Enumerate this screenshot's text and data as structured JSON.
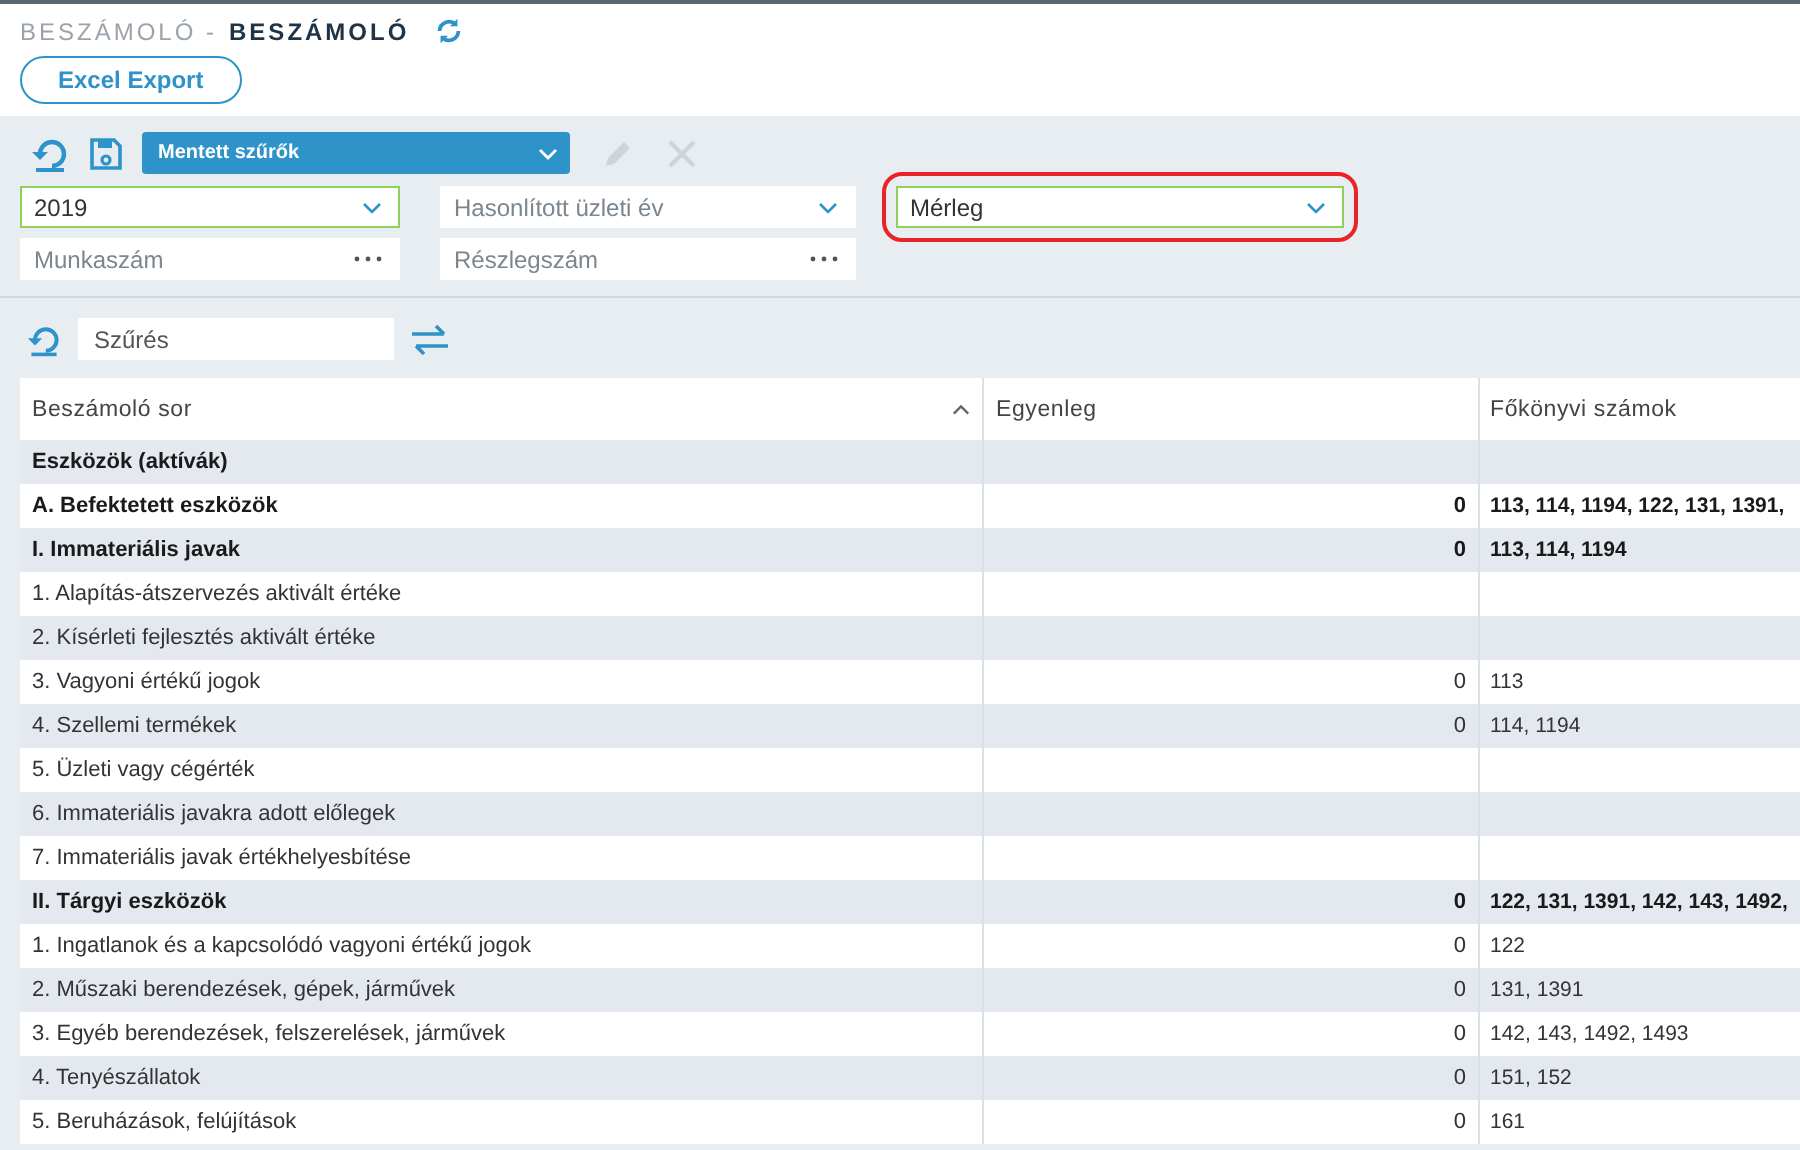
{
  "header": {
    "breadcrumb": "BESZÁMOLÓ -",
    "title": "BESZÁMOLÓ",
    "export_button": "Excel Export"
  },
  "filters": {
    "saved_filters": "Mentett szűrők",
    "edit_disabled": true,
    "delete_disabled": true,
    "fields": [
      {
        "kind": "select",
        "value": "2019",
        "valid": true,
        "highlighted": false
      },
      {
        "kind": "select",
        "placeholder": "Hasonlított üzleti év",
        "valid": false,
        "highlighted": false
      },
      {
        "kind": "select",
        "value": "Mérleg",
        "valid": true,
        "highlighted": true
      },
      {
        "kind": "lookup",
        "placeholder": "Munkaszám",
        "valid": false,
        "highlighted": false
      },
      {
        "kind": "lookup",
        "placeholder": "Részlegszám",
        "valid": false,
        "highlighted": false
      }
    ],
    "search_placeholder": "Szűrés"
  },
  "table": {
    "columns": [
      "Beszámoló sor",
      "Egyenleg",
      "Főkönyvi számok"
    ],
    "rows": [
      {
        "label": "Eszközök (aktívák)",
        "bold": true
      },
      {
        "label": "A. Befektetett eszközök",
        "balance": "0",
        "accounts": "113, 114, 1194, 122, 131, 1391,",
        "bold": true
      },
      {
        "label": "I. Immateriális javak",
        "balance": "0",
        "accounts": "113, 114, 1194",
        "bold": true
      },
      {
        "label": "1. Alapítás-átszervezés aktivált értéke",
        "bold": false
      },
      {
        "label": "2. Kísérleti fejlesztés aktivált értéke",
        "bold": false
      },
      {
        "label": "3. Vagyoni értékű jogok",
        "balance": "0",
        "accounts": "113",
        "bold": false
      },
      {
        "label": "4. Szellemi termékek",
        "balance": "0",
        "accounts": "114, 1194",
        "bold": false
      },
      {
        "label": "5. Üzleti vagy cégérték",
        "bold": false
      },
      {
        "label": "6. Immateriális javakra adott előlegek",
        "bold": false
      },
      {
        "label": "7. Immateriális javak értékhelyesbítése",
        "bold": false
      },
      {
        "label": "II. Tárgyi eszközök",
        "balance": "0",
        "accounts": "122, 131, 1391, 142, 143, 1492,",
        "bold": true
      },
      {
        "label": "1. Ingatlanok és a kapcsolódó vagyoni értékű jogok",
        "balance": "0",
        "accounts": "122",
        "bold": false
      },
      {
        "label": "2. Műszaki berendezések, gépek, járművek",
        "balance": "0",
        "accounts": "131, 1391",
        "bold": false
      },
      {
        "label": "3. Egyéb berendezések, felszerelések, járművek",
        "balance": "0",
        "accounts": "142, 143, 1492, 1493",
        "bold": false
      },
      {
        "label": "4. Tenyészállatok",
        "balance": "0",
        "accounts": "151, 152",
        "bold": false
      },
      {
        "label": "5. Beruházások, felújítások",
        "balance": "0",
        "accounts": "161",
        "bold": false
      }
    ]
  }
}
